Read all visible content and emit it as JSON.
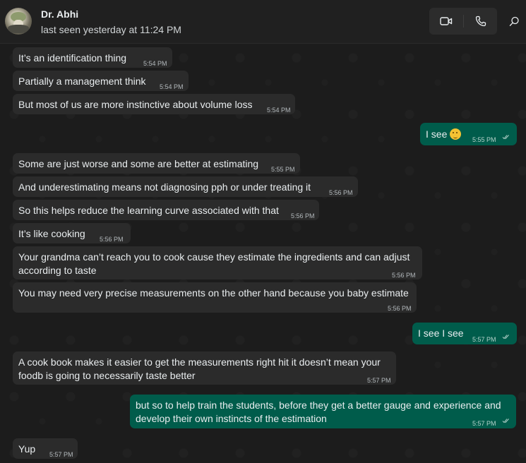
{
  "header": {
    "name": "Dr. Abhi",
    "status": "last seen yesterday at 11:24 PM",
    "icons": {
      "video": "video-call-icon",
      "voice": "phone-icon",
      "search": "search-icon"
    }
  },
  "colors": {
    "incoming": "#2b2b2b",
    "outgoing": "#005c4b",
    "background": "#1c1c1c"
  },
  "messages": [
    {
      "dir": "in",
      "text": "It’s an identification thing",
      "time": "5:54 PM"
    },
    {
      "dir": "in",
      "text": "Partially a management think",
      "time": "5:54 PM"
    },
    {
      "dir": "in",
      "text": "But most of us are more instinctive about volume loss",
      "time": "5:54 PM"
    },
    {
      "dir": "out",
      "text": "I see",
      "emoji": "thinking-face",
      "time": "5:55 PM",
      "status": "read"
    },
    {
      "dir": "in",
      "text": "Some are just worse and some are better at estimating",
      "time": "5:55 PM"
    },
    {
      "dir": "in",
      "text": "And underestimating means not diagnosing pph or under treating it",
      "time": "5:56 PM"
    },
    {
      "dir": "in",
      "text": "So this helps reduce the learning curve associated with that",
      "time": "5:56 PM"
    },
    {
      "dir": "in",
      "text": "It’s like cooking",
      "time": "5:56 PM"
    },
    {
      "dir": "in",
      "text": "Your grandma can’t reach you to cook cause they estimate the ingredients and can adjust according to taste",
      "time": "5:56 PM"
    },
    {
      "dir": "in",
      "text": "You may need very precise measurements on the other hand because you baby estimate",
      "time": "5:56 PM"
    },
    {
      "dir": "out",
      "text": "I see I see",
      "time": "5:57 PM",
      "status": "read"
    },
    {
      "dir": "in",
      "text": "A cook book makes it easier to get the measurements right hit it doesn’t mean your foodb is going to necessarily taste better",
      "time": "5:57 PM"
    },
    {
      "dir": "out",
      "text": "but so to help train the students, before they get a better gauge and experience and develop their own instincts of the estimation",
      "time": "5:57 PM",
      "status": "read"
    },
    {
      "dir": "in",
      "text": "Yup",
      "time": "5:57 PM"
    }
  ]
}
